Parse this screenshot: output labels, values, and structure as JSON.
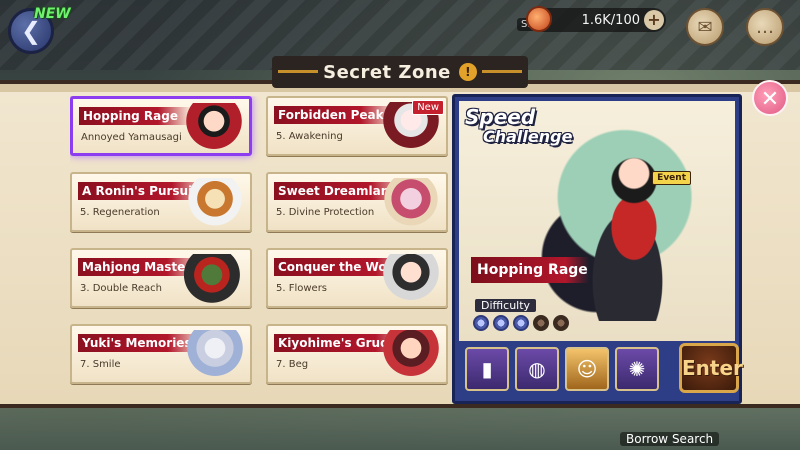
{
  "top_left": {
    "new_label": "NEW",
    "back_icon": "back-arrow-icon"
  },
  "currency": {
    "amount": "1.6K/100",
    "shop_label": "Sh"
  },
  "icons": {
    "mail": "mail-icon",
    "chat": "chat-icon"
  },
  "panel": {
    "title": "Secret Zone"
  },
  "zones": [
    {
      "name": "Hopping Rage",
      "stage": "Annoyed Yamausagi",
      "selected": true,
      "new": ""
    },
    {
      "name": "Forbidden Peak",
      "stage": "5. Awakening",
      "selected": false,
      "new": "New"
    },
    {
      "name": "A Ronin's Pursuit",
      "stage": "5. Regeneration",
      "selected": false,
      "new": ""
    },
    {
      "name": "Sweet Dreamland",
      "stage": "5. Divine Protection",
      "selected": false,
      "new": ""
    },
    {
      "name": "Mahjong Master",
      "stage": "3. Double Reach",
      "selected": false,
      "new": ""
    },
    {
      "name": "Conquer the World",
      "stage": "5. Flowers",
      "selected": false,
      "new": ""
    },
    {
      "name": "Yuki's Memories",
      "stage": "7. Smile",
      "selected": false,
      "new": ""
    },
    {
      "name": "Kiyohime's Grudge",
      "stage": "7. Beg",
      "selected": false,
      "new": ""
    }
  ],
  "detail": {
    "speed_title": "Speed",
    "speed_subtitle": "Challenge",
    "event_tag": "Event",
    "boss_name": "Hopping Rage",
    "difficulty_label": "Difficulty",
    "difficulty_filled": 3,
    "difficulty_total": 5,
    "enter_label": "Enter"
  },
  "bottom": {
    "borrow_search": "Borrow Search"
  }
}
